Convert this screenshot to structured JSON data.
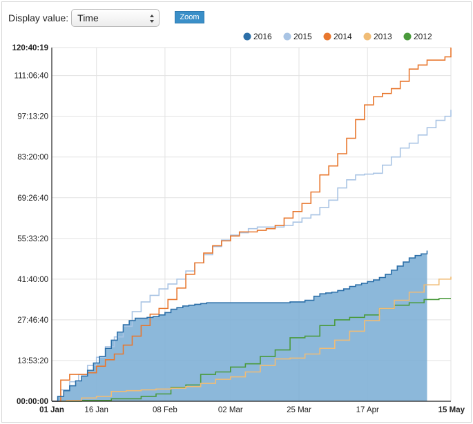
{
  "controls": {
    "display_label": "Display value:",
    "display_selected": "Time",
    "zoom_label": "Zoom"
  },
  "chart_data": {
    "type": "line",
    "x_unit": "date",
    "xlim": [
      "01 Jan",
      "15 May"
    ],
    "ylim": [
      0,
      434419
    ],
    "y_format": "hh:mm:ss",
    "x_ticks": [
      "01 Jan",
      "16 Jan",
      "08 Feb",
      "02 Mar",
      "25 Mar",
      "17 Apr",
      "15 May"
    ],
    "x_ticks_day_index": [
      0,
      15,
      38,
      60,
      83,
      106,
      134
    ],
    "x_ticks_bold": [
      "01 Jan",
      "15 May"
    ],
    "y_ticks": [
      "00:00:00",
      "13:53:20",
      "27:46:40",
      "41:40:00",
      "55:33:20",
      "69:26:40",
      "83:20:00",
      "97:13:20",
      "111:06:40",
      "120:40:19"
    ],
    "y_ticks_seconds": [
      0,
      50000,
      100000,
      150000,
      200000,
      250000,
      300000,
      350000,
      400000,
      434419
    ],
    "y_ticks_bold": [
      "00:00:00",
      "120:40:19"
    ],
    "grid": true,
    "legend_position": "top-right",
    "series": [
      {
        "name": "2016",
        "color": "#2c6fa8",
        "fill": "#7fb0d6",
        "area": true,
        "step": true,
        "x": [
          0,
          2,
          4,
          6,
          8,
          10,
          12,
          14,
          16,
          18,
          20,
          22,
          24,
          26,
          28,
          30,
          32,
          34,
          36,
          38,
          40,
          42,
          44,
          46,
          48,
          50,
          52,
          54,
          56,
          58,
          60,
          65,
          70,
          75,
          80,
          85,
          88,
          90,
          92,
          94,
          96,
          98,
          100,
          102,
          104,
          106,
          108,
          110,
          112,
          114,
          116,
          118,
          120,
          122,
          124,
          126
        ],
        "y": [
          0,
          6000,
          13000,
          19000,
          25000,
          31000,
          38000,
          47000,
          55000,
          65000,
          75000,
          85000,
          94000,
          99000,
          102000,
          102000,
          103000,
          104000,
          106000,
          109000,
          113000,
          115000,
          117000,
          118000,
          119000,
          120000,
          121000,
          121000,
          121000,
          121000,
          121000,
          121000,
          121000,
          121000,
          122000,
          124000,
          129000,
          132000,
          133000,
          134000,
          136000,
          138000,
          141000,
          143000,
          145000,
          147000,
          149000,
          152000,
          156000,
          161000,
          166000,
          171000,
          176000,
          179000,
          181000,
          185000
        ]
      },
      {
        "name": "2015",
        "color": "#a9c4e4",
        "step": true,
        "x": [
          0,
          3,
          6,
          9,
          12,
          15,
          18,
          21,
          24,
          27,
          30,
          33,
          36,
          39,
          42,
          45,
          48,
          51,
          54,
          57,
          60,
          63,
          66,
          69,
          72,
          75,
          78,
          81,
          84,
          87,
          90,
          93,
          96,
          99,
          102,
          105,
          108,
          111,
          114,
          117,
          120,
          123,
          126,
          129,
          132,
          134
        ],
        "y": [
          0,
          14000,
          24000,
          33000,
          44000,
          54000,
          67000,
          79000,
          92000,
          110000,
          122000,
          130000,
          138000,
          144000,
          150000,
          160000,
          170000,
          180000,
          190000,
          198000,
          204000,
          207000,
          212000,
          214000,
          214000,
          214000,
          216000,
          220000,
          225000,
          229000,
          238000,
          247000,
          262000,
          272000,
          278000,
          279000,
          280000,
          290000,
          300000,
          311000,
          317000,
          327000,
          336000,
          345000,
          350000,
          358000
        ]
      },
      {
        "name": "2014",
        "color": "#e8772e",
        "step": true,
        "x": [
          0,
          3,
          6,
          9,
          12,
          15,
          18,
          21,
          24,
          27,
          30,
          33,
          36,
          39,
          42,
          45,
          48,
          51,
          54,
          57,
          60,
          63,
          66,
          69,
          72,
          75,
          78,
          81,
          84,
          87,
          90,
          93,
          96,
          99,
          102,
          105,
          108,
          111,
          114,
          117,
          120,
          123,
          126,
          129,
          132,
          134
        ],
        "y": [
          0,
          26000,
          33000,
          33000,
          35000,
          43000,
          51000,
          58000,
          69000,
          80000,
          93000,
          107000,
          114000,
          125000,
          139000,
          156000,
          170000,
          182000,
          191000,
          197000,
          203000,
          208000,
          208000,
          210000,
          212000,
          216000,
          225000,
          233000,
          243000,
          257000,
          278000,
          289000,
          304000,
          323000,
          346000,
          364000,
          374000,
          378000,
          384000,
          393000,
          408000,
          413000,
          419000,
          419000,
          423000,
          434419
        ]
      },
      {
        "name": "2013",
        "color": "#f0bc76",
        "step": true,
        "x": [
          0,
          5,
          10,
          15,
          20,
          25,
          30,
          35,
          40,
          45,
          50,
          55,
          60,
          65,
          70,
          75,
          80,
          85,
          90,
          95,
          100,
          105,
          110,
          115,
          120,
          125,
          130,
          134
        ],
        "y": [
          0,
          1000,
          4000,
          6000,
          12000,
          13000,
          14000,
          15000,
          16000,
          18000,
          22000,
          27000,
          30000,
          36000,
          44000,
          52000,
          53000,
          58000,
          65000,
          75000,
          86000,
          99000,
          114000,
          124000,
          134000,
          143000,
          150000,
          153000
        ]
      },
      {
        "name": "2012",
        "color": "#4a9a3c",
        "step": true,
        "x": [
          0,
          10,
          20,
          30,
          35,
          40,
          45,
          50,
          55,
          60,
          65,
          70,
          75,
          80,
          85,
          90,
          95,
          100,
          105,
          110,
          115,
          120,
          125,
          130,
          134
        ],
        "y": [
          0,
          1000,
          3000,
          6000,
          9000,
          17000,
          20000,
          33000,
          36000,
          42000,
          46000,
          55000,
          63000,
          78000,
          80000,
          93000,
          100000,
          103000,
          106000,
          114000,
          118000,
          121000,
          125000,
          126000,
          126000
        ]
      }
    ]
  }
}
